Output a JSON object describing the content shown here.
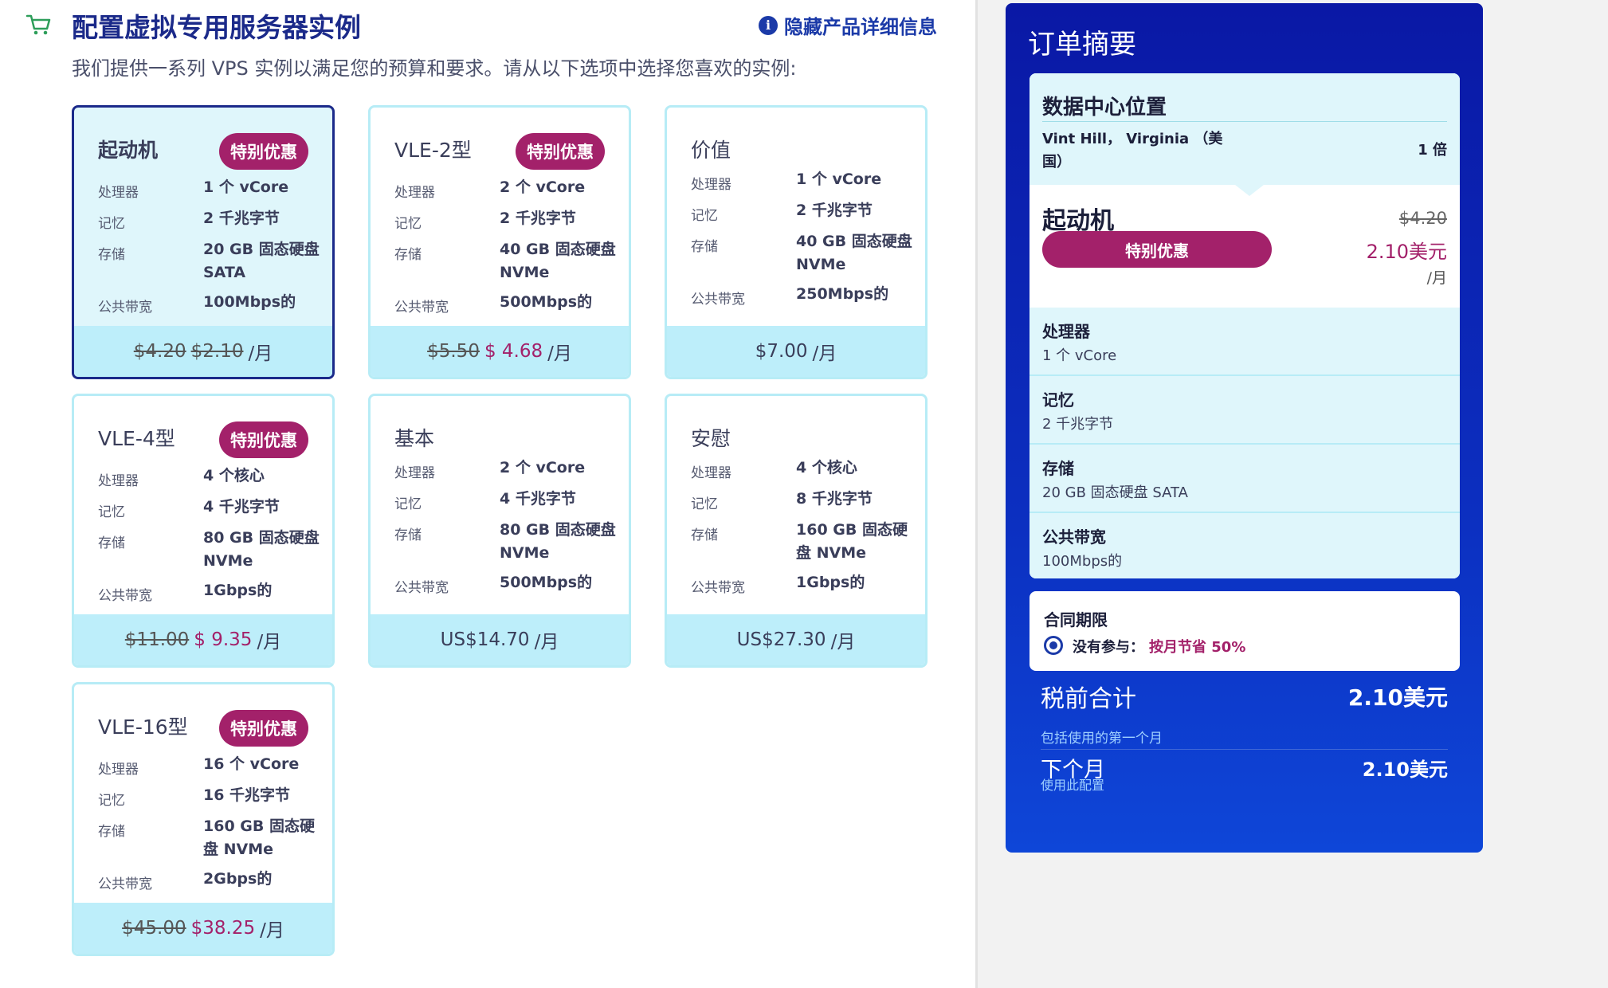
{
  "header": {
    "title": "配置虚拟专用服务器实例",
    "hide_link": "隐藏产品详细信息",
    "subtitle": "我们提供一系列 VPS 实例以满足您的预算和要求。请从以下选项中选择您喜欢的实例:"
  },
  "spec_labels": {
    "cpu": "处理器",
    "memory": "记忆",
    "storage": "存储",
    "bandwidth": "公共带宽"
  },
  "plans": [
    {
      "name": "起动机",
      "badge": "特别优惠",
      "cpu": "1 个 vCore",
      "memory": "2 千兆字节",
      "storage": "20 GB 固态硬盘 SATA",
      "bandwidth": "100Mbps的",
      "old_price": "$4.20",
      "price": "$2.10",
      "per": "/月",
      "selected": true
    },
    {
      "name": "VLE-2型",
      "badge": "特别优惠",
      "cpu": "2 个 vCore",
      "memory": "2 千兆字节",
      "storage": "40 GB 固态硬盘 NVMe",
      "bandwidth": "500Mbps的",
      "old_price": "$5.50",
      "price": "$ 4.68",
      "per": "/月"
    },
    {
      "name": "价值",
      "badge": "",
      "cpu": "1 个 vCore",
      "memory": "2 千兆字节",
      "storage": "40 GB 固态硬盘 NVMe",
      "bandwidth": "250Mbps的",
      "old_price": "",
      "price": "$7.00",
      "per": "/月"
    },
    {
      "name": "VLE-4型",
      "badge": "特别优惠",
      "cpu": "4 个核心",
      "memory": "4 千兆字节",
      "storage": "80 GB 固态硬盘 NVMe",
      "bandwidth": "1Gbps的",
      "old_price": "$11.00",
      "price": "$ 9.35",
      "per": "/月"
    },
    {
      "name": "基本",
      "badge": "",
      "cpu": "2 个 vCore",
      "memory": "4 千兆字节",
      "storage": "80 GB 固态硬盘 NVMe",
      "bandwidth": "500Mbps的",
      "old_price": "",
      "price": "US$14.70",
      "per": "/月"
    },
    {
      "name": "安慰",
      "badge": "",
      "cpu": "4 个核心",
      "memory": "8 千兆字节",
      "storage": "160 GB 固态硬盘 NVMe",
      "bandwidth": "1Gbps的",
      "old_price": "",
      "price": "US$27.30",
      "per": "/月"
    },
    {
      "name": "VLE-16型",
      "badge": "特别优惠",
      "cpu": "16 个 vCore",
      "memory": "16 千兆字节",
      "storage": "160 GB 固态硬盘 NVMe",
      "bandwidth": "2Gbps的",
      "old_price": "$45.00",
      "price": "$38.25",
      "per": "/月"
    }
  ],
  "summary": {
    "title": "订单摘要",
    "datacenter_title": "数据中心位置",
    "location": "Vint Hill， Virginia （美国）",
    "quantity": "1 倍",
    "plan_name": "起动机",
    "plan_badge": "特别优惠",
    "old_price": "$4.20",
    "price": "2.10美元",
    "per": "/月",
    "specs": [
      {
        "label": "处理器",
        "value": "1 个 vCore"
      },
      {
        "label": "记忆",
        "value": "2 千兆字节"
      },
      {
        "label": "存储",
        "value": "20 GB 固态硬盘 SATA"
      },
      {
        "label": "公共带宽",
        "value": "100Mbps的"
      }
    ],
    "contract_title": "合同期限",
    "contract_option": "没有参与：",
    "contract_save": "按月节省 50%",
    "subtotal_label": "税前合计",
    "subtotal_value": "2.10美元",
    "first_month": "包括使用的第一个月",
    "next_month_label": "下个月",
    "next_month_value": "2.10美元",
    "use_config": "使用此配置"
  },
  "colors": {
    "brand_navy": "#1b2a8a",
    "promo_magenta": "#a3216a",
    "card_border": "#b7ecf6",
    "price_bar": "#bdeefa",
    "summary_blue": "#0a18a5"
  }
}
